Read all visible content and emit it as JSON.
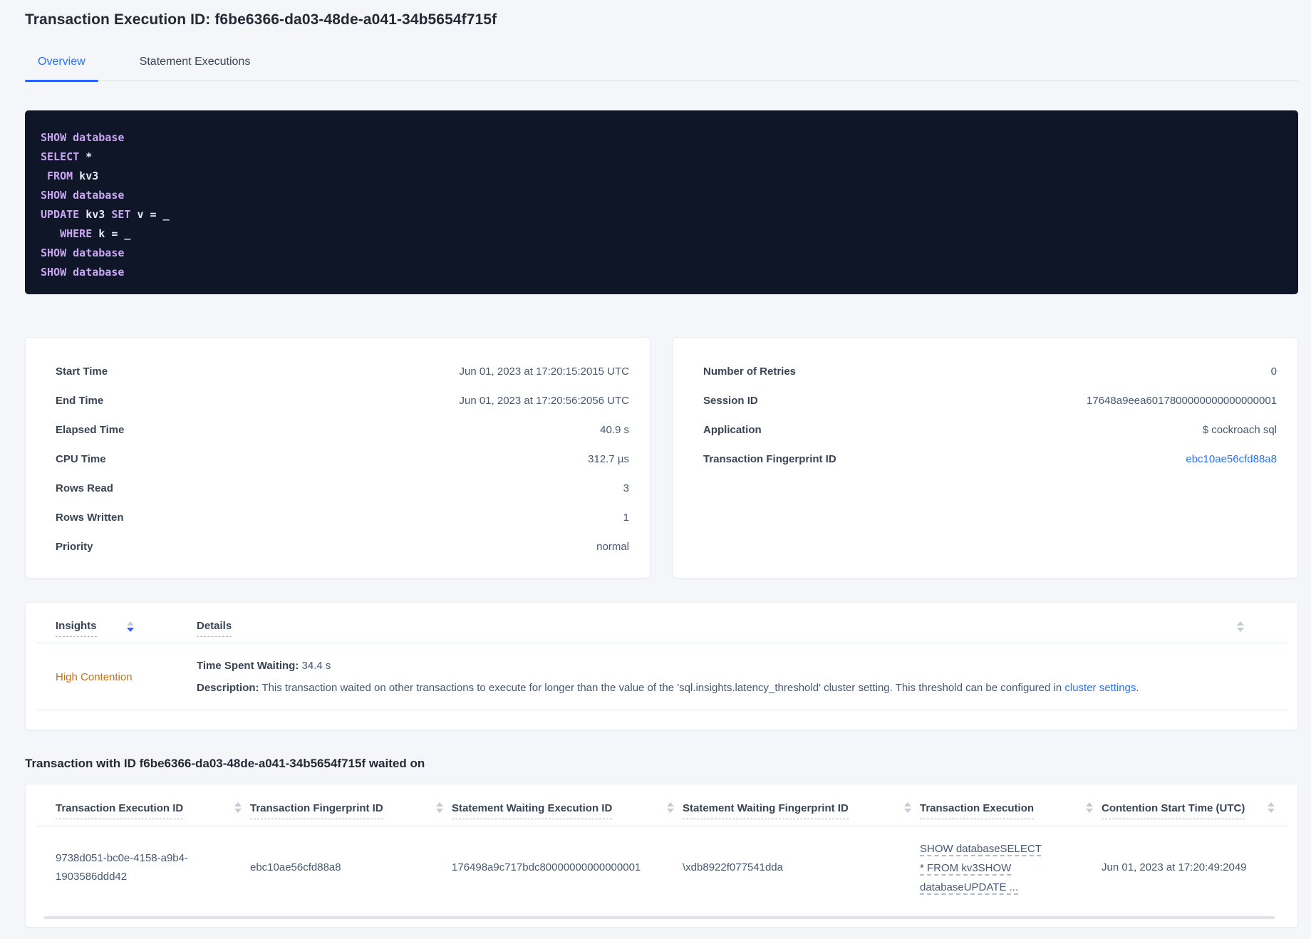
{
  "header": {
    "title": "Transaction Execution ID: f6be6366-da03-48de-a041-34b5654f715f",
    "tabs": [
      {
        "label": "Overview",
        "active": true
      },
      {
        "label": "Statement Executions",
        "active": false
      }
    ]
  },
  "sql": {
    "lines": [
      [
        {
          "text": "SHOW database",
          "kw": true
        }
      ],
      [
        {
          "text": "SELECT",
          "kw": true
        },
        {
          "text": " *",
          "kw": false
        }
      ],
      [
        {
          "text": " ",
          "kw": false
        },
        {
          "text": "FROM",
          "kw": true
        },
        {
          "text": " kv3",
          "kw": false
        }
      ],
      [
        {
          "text": "SHOW database",
          "kw": true
        }
      ],
      [
        {
          "text": "UPDATE",
          "kw": true
        },
        {
          "text": " kv3 ",
          "kw": false
        },
        {
          "text": "SET",
          "kw": true
        },
        {
          "text": " v = _",
          "kw": false
        }
      ],
      [
        {
          "text": "   ",
          "kw": false
        },
        {
          "text": "WHERE",
          "kw": true
        },
        {
          "text": " k = _",
          "kw": false
        }
      ],
      [
        {
          "text": "SHOW database",
          "kw": true
        }
      ],
      [
        {
          "text": "SHOW database",
          "kw": true
        }
      ]
    ]
  },
  "details_left": {
    "rows": [
      {
        "label": "Start Time",
        "value": "Jun 01, 2023 at 17:20:15:2015 UTC"
      },
      {
        "label": "End Time",
        "value": "Jun 01, 2023 at 17:20:56:2056 UTC"
      },
      {
        "label": "Elapsed Time",
        "value": "40.9 s"
      },
      {
        "label": "CPU Time",
        "value": "312.7 µs"
      },
      {
        "label": "Rows Read",
        "value": "3"
      },
      {
        "label": "Rows Written",
        "value": "1"
      },
      {
        "label": "Priority",
        "value": "normal"
      }
    ]
  },
  "details_right": {
    "rows": [
      {
        "label": "Number of Retries",
        "value": "0"
      },
      {
        "label": "Session ID",
        "value": "17648a9eea6017800000000000000001"
      },
      {
        "label": "Application",
        "value": "$ cockroach sql"
      },
      {
        "label": "Transaction Fingerprint ID",
        "value": "ebc10ae56cfd88a8"
      }
    ]
  },
  "insights_table": {
    "insights_header": "Insights",
    "details_header": "Details",
    "row": {
      "insight": "High Contention",
      "time_spent_waiting_label": "Time Spent Waiting:",
      "time_spent_waiting_value": " 34.4 s",
      "description_label": "Description:",
      "description_text": " This transaction waited on other transactions to execute for longer than the value of the 'sql.insights.latency_threshold' cluster setting. This threshold can be configured in ",
      "description_link": "cluster settings",
      "description_end": "."
    }
  },
  "waited_on": {
    "heading": "Transaction with ID f6be6366-da03-48de-a041-34b5654f715f waited on",
    "columns": [
      "Transaction Execution ID",
      "Transaction Fingerprint ID",
      "Statement Waiting Execution ID",
      "Statement Waiting Fingerprint ID",
      "Transaction Execution",
      "Contention Start Time (UTC)"
    ],
    "rows": [
      {
        "transaction_execution_id": "9738d051-bc0e-4158-a9b4-1903586ddd42",
        "transaction_fingerprint_id": "ebc10ae56cfd88a8",
        "statement_waiting_execution_id": "176498a9c717bdc80000000000000001",
        "statement_waiting_fingerprint_id": "\\xdb8922f077541dda",
        "transaction_execution": "SHOW databaseSELECT * FROM kv3SHOW databaseUPDATE ...",
        "contention_start_time": "Jun 01, 2023 at 17:20:49:2049"
      }
    ]
  },
  "colors": {
    "accent_blue": "#2970ff",
    "insight_orange": "#c26f15",
    "code_background": "#0e1627",
    "code_keyword": "#c9a5f2",
    "code_text": "#e7eaf4",
    "page_background": "#f4f6fa"
  }
}
